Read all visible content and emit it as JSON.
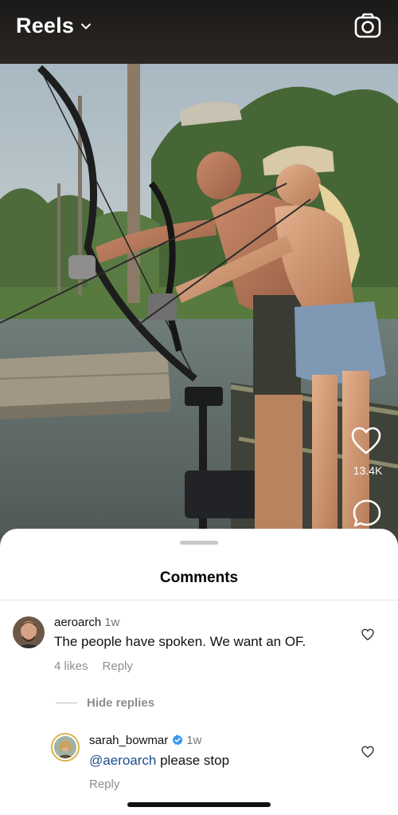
{
  "header": {
    "title": "Reels",
    "camera_icon": "camera-icon",
    "dropdown_icon": "chevron-down-icon"
  },
  "reel": {
    "like_count": "13.4K",
    "like_icon": "heart-outline-icon",
    "comment_icon": "comment-bubble-icon"
  },
  "comments_sheet": {
    "title": "Comments",
    "comments": [
      {
        "username": "aeroarch",
        "time": "1w",
        "text": "The people have spoken. We want an OF.",
        "likes": "4 likes",
        "reply_label": "Reply"
      }
    ],
    "hide_replies_label": "Hide replies",
    "replies": [
      {
        "username": "sarah_bowmar",
        "verified": true,
        "time": "1w",
        "mention": "@aeroarch",
        "text": " please stop",
        "reply_label": "Reply"
      }
    ]
  },
  "colors": {
    "mention": "#1f4e8c",
    "verified": "#3897f0",
    "muted_text": "#8e8e8e"
  }
}
